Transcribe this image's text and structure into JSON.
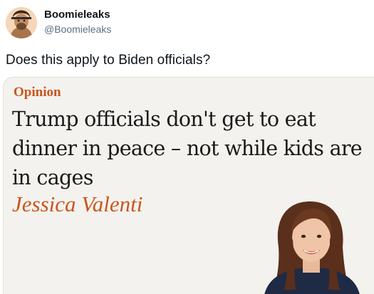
{
  "tweet": {
    "author_name": "Boomieleaks",
    "author_handle": "@Boomieleaks",
    "text": "Does this apply to Biden officials?"
  },
  "card": {
    "section": "Opinion",
    "headline": "Trump officials don't get to eat dinner in peace – not while kids are in cages",
    "byline": "Jessica Valenti"
  },
  "colors": {
    "accent": "#c8561c",
    "card_background": "#f4f2ee",
    "handle": "#5b7083"
  }
}
